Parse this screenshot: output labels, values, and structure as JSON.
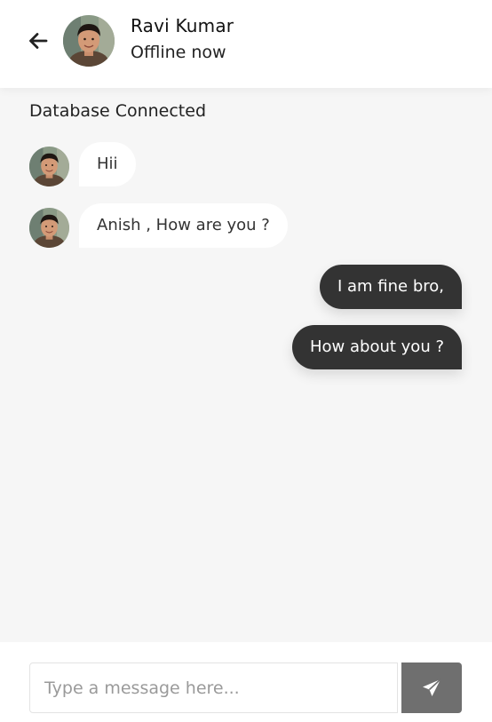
{
  "header": {
    "back_icon": "arrow-left-icon",
    "avatar_icon": "user-avatar",
    "name": "Ravi Kumar",
    "status": "Offline now"
  },
  "chat": {
    "system_status": "Database Connected",
    "messages": [
      {
        "direction": "incoming",
        "text": "Hii"
      },
      {
        "direction": "incoming",
        "text": "Anish , How are you ?"
      },
      {
        "direction": "outgoing",
        "text": "I am fine bro,"
      },
      {
        "direction": "outgoing",
        "text": "How about you ?"
      }
    ]
  },
  "composer": {
    "placeholder": "Type a message here...",
    "value": "",
    "send_icon": "paper-plane-icon"
  },
  "colors": {
    "chat_background": "#f6f6f6",
    "incoming_bubble": "#ffffff",
    "outgoing_bubble": "#333333",
    "send_button": "#6f6f6f"
  }
}
